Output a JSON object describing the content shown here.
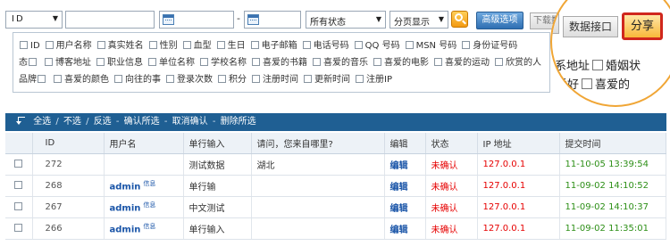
{
  "toolbar": {
    "id_select": "ID",
    "id_input": "",
    "date_start": "",
    "date_separator": "-",
    "date_end": "",
    "status_select": "所有状态",
    "pagination_select": "分页显示",
    "advanced_button": "高级选项",
    "download_button": "下载数据"
  },
  "fields": [
    "ID",
    "用户名称",
    "真实姓名",
    "性别",
    "血型",
    "生日",
    "电子邮箱",
    "电话号码",
    "QQ 号码",
    "MSN 号码",
    "身份证号码",
    "态",
    "博客地址",
    "职业信息",
    "单位名称",
    "学校名称",
    "喜爱的书籍",
    "喜爱的音乐",
    "喜爱的电影",
    "喜爱的运动",
    "欣赏的人",
    "品牌",
    "喜爱的颜色",
    "向往的事",
    "登录次数",
    "积分",
    "注册时间",
    "更新时间",
    "注册IP"
  ],
  "callout": {
    "api_button": "数据接口",
    "share_button": "分享",
    "row1_a": "系地址",
    "row1_b": "婚姻状",
    "row2_a": "爱好",
    "row2_b": "喜爱的"
  },
  "action_bar": {
    "select_all": "全选",
    "deselect": "不选",
    "invert": "反选",
    "confirm_selected": "确认所选",
    "cancel_confirm": "取消确认",
    "delete_selected": "删除所选",
    "separator": "/",
    "dash": "-"
  },
  "table": {
    "headers": [
      "ID",
      "用户名",
      "单行输入",
      "请问，您来自哪里?",
      "编辑",
      "状态",
      "IP 地址",
      "提交时间"
    ],
    "rows": [
      {
        "id": "272",
        "user": "",
        "user_info": "",
        "single": "测试数据",
        "question": "湖北",
        "edit": "编辑",
        "status": "未确认",
        "ip": "127.0.0.1",
        "time": "11-10-05 13:39:54"
      },
      {
        "id": "268",
        "user": "admin",
        "user_info": "信息",
        "single": "单行输",
        "question": "",
        "edit": "编辑",
        "status": "未确认",
        "ip": "127.0.0.1",
        "time": "11-09-02 14:10:52"
      },
      {
        "id": "267",
        "user": "admin",
        "user_info": "信息",
        "single": "中文测试",
        "question": "",
        "edit": "编辑",
        "status": "未确认",
        "ip": "127.0.0.1",
        "time": "11-09-02 14:10:37"
      },
      {
        "id": "266",
        "user": "admin",
        "user_info": "信息",
        "single": "单行输入",
        "question": "",
        "edit": "编辑",
        "status": "未确认",
        "ip": "127.0.0.1",
        "time": "11-09-02 11:35:01"
      }
    ]
  },
  "colors": {
    "action_bar": "#1f5f93",
    "status_unconfirmed": "#e60000",
    "time_green": "#2d8f17",
    "link_blue": "#1a55a8",
    "callout_ring": "#f0a636",
    "share_border": "#d0271d"
  }
}
